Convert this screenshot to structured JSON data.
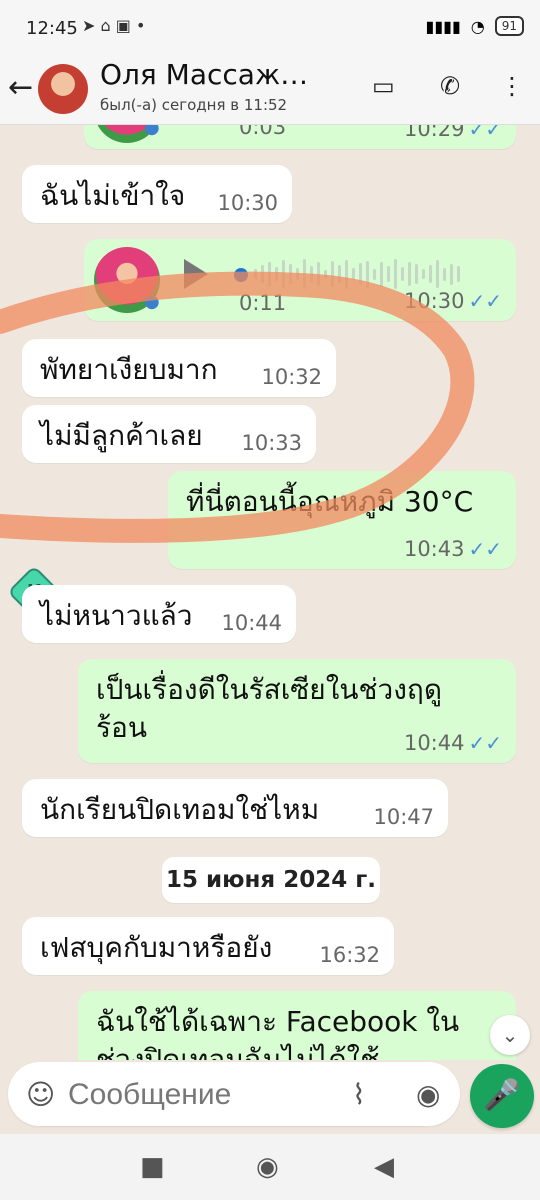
{
  "status": {
    "time": "12:45",
    "left_icons": "➤ ⌂ ▣ •",
    "battery": "91"
  },
  "chat": {
    "contact_name": "Оля Массаж…",
    "contact_status": "был(-а) сегодня в 11:52"
  },
  "messages": [
    {
      "text": "0:03",
      "time": "10:29"
    },
    {
      "text": "ฉันไม่เข้าใจ",
      "time": "10:30"
    },
    {
      "text": "0:11",
      "time": "10:30"
    },
    {
      "text": "พัทยาเงียบมาก",
      "time": "10:32"
    },
    {
      "text": "ไม่มีลูกค้าเลย",
      "time": "10:33"
    },
    {
      "text": "ที่นี่ตอนนี้อุณหภูมิ 30°C",
      "time": "10:43"
    },
    {
      "text": "ไม่หนาวแล้ว",
      "time": "10:44"
    },
    {
      "text": "เป็นเรื่องดีในรัสเซียในช่วงฤดู",
      "text2": "ร้อน",
      "time": "10:44"
    },
    {
      "text": "นักเรียนปิดเทอมใช่ไหม",
      "time": "10:47"
    },
    {
      "text": "เฟสบุคกับมาหรือยัง",
      "time": "16:32"
    },
    {
      "text": "ฉันใช้ได้เฉพาะ Facebook ใน",
      "text2": "ช่วงปิดเทอมฉันไม่ได้ใช้",
      "time": ""
    }
  ],
  "date_separator": "15 июня 2024 г.",
  "input": {
    "placeholder": "Сообщение"
  },
  "icons": {
    "back": "back-arrow-icon",
    "video": "video-icon",
    "call": "phone-icon",
    "menu": "menu-icon",
    "emoji": "emoji-icon",
    "attach": "paperclip-icon",
    "camera": "camera-icon",
    "mic": "mic-icon",
    "scroll": "chevrons-down-icon",
    "nav_recent": "square-icon",
    "nav_home": "circle-icon",
    "nav_back": "triangle-back-icon"
  },
  "colors": {
    "out_bubble": "#d9fdd3",
    "in_bubble": "#ffffff",
    "accent": "#19a35c",
    "tick": "#4b8fd3",
    "doodle": "#f08a5d"
  }
}
